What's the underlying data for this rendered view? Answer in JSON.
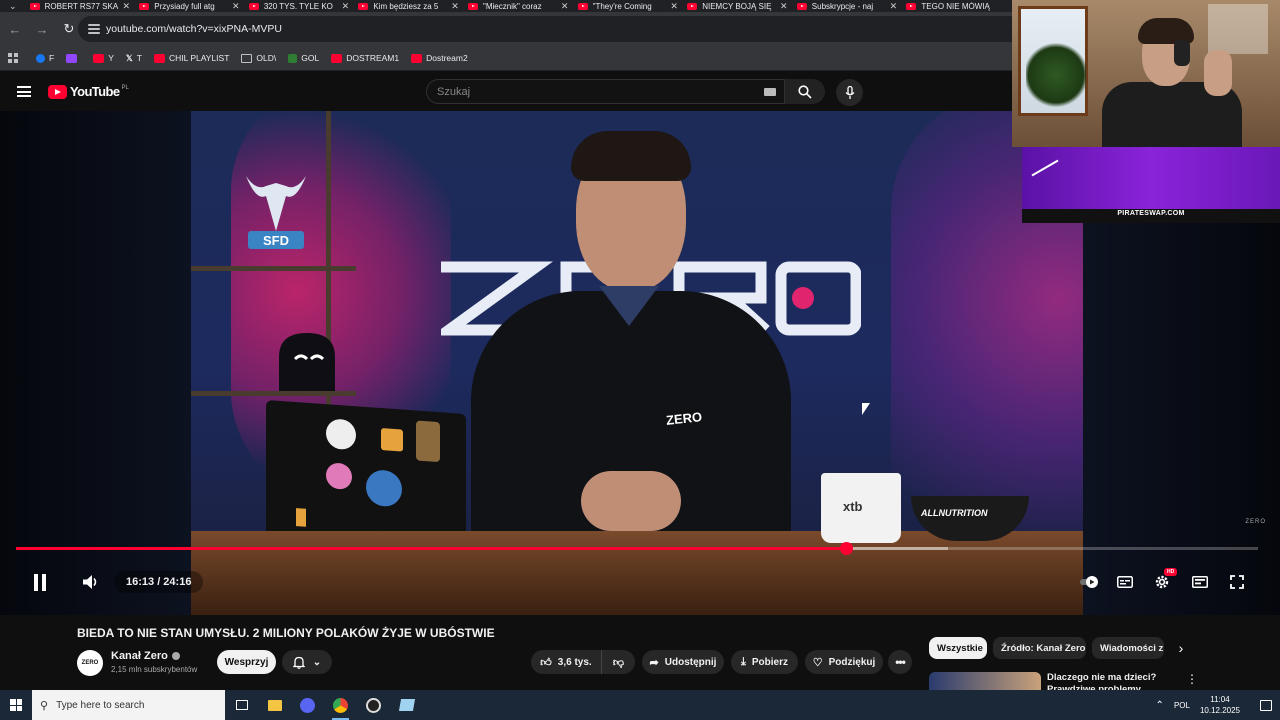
{
  "browser": {
    "tabs": [
      {
        "title": "ROBERT RS77 SKA"
      },
      {
        "title": "Przysiady full atg"
      },
      {
        "title": "320 TYS. TYLE KO"
      },
      {
        "title": "Kim będziesz za 5"
      },
      {
        "title": "\"Miecznik\" coraz"
      },
      {
        "title": "\"They're Coming"
      },
      {
        "title": "NIEMCY BOJĄ SIĘ"
      },
      {
        "title": "Subskrypcje - naj"
      },
      {
        "title": "TEGO NIE MÓWIĄ"
      }
    ],
    "url": "youtube.com/watch?v=xixPNA-MVPU",
    "bookmarks": [
      {
        "label": "F",
        "color": "#1877f2"
      },
      {
        "label": "",
        "color": "#9146ff"
      },
      {
        "label": "Y",
        "color": "#ff0033"
      },
      {
        "label": "T",
        "color": "#000000"
      },
      {
        "label": "CHIL PLAYLIST",
        "color": "#ff0033"
      },
      {
        "label": "OLD\\",
        "color": "folder"
      },
      {
        "label": "GOL",
        "color": "#2e7d32"
      },
      {
        "label": "DOSTREAM1",
        "color": "#ff0033"
      },
      {
        "label": "Dostream2",
        "color": "#ff0033"
      }
    ]
  },
  "youtube": {
    "logo_text": "YouTube",
    "country_code": "PL",
    "search_placeholder": "Szukaj"
  },
  "player": {
    "current_time": "16:13",
    "duration": "24:16",
    "time_display": "16:13 / 24:16",
    "progress": 0.668,
    "buffered": 0.75,
    "hd_badge": "HD",
    "watermark": "ZERO",
    "video_zero_logo": "ZERO",
    "mug_brand": "xtb",
    "bowl_brand": "ALLNUTRITION"
  },
  "video_info": {
    "title": "BIEDA TO NIE STAN UMYSŁU. 2 MILIONY POLAKÓW ŻYJE W UBÓSTWIE",
    "channel_name": "Kanał Zero",
    "channel_avatar_text": "ZERO",
    "subscribers": "2,15 mln subskrybentów",
    "support_button": "Wesprzyj",
    "likes": "3,6 tys.",
    "share": "Udostępnij",
    "download": "Pobierz",
    "thanks": "Podziękuj"
  },
  "sidebar": {
    "chips": [
      "Wszystkie",
      "Źródło: Kanał Zero",
      "Wiadomości z"
    ],
    "rec_title": "Dlaczego nie ma dzieci? Prawdziwe problemy młodych"
  },
  "stream_overlay": {
    "banner_text": "PIRATESWAP.COM"
  },
  "taskbar": {
    "search_placeholder": "Type here to search",
    "language": "POL",
    "time": "11:04",
    "date": "10.12.2025"
  },
  "colors": {
    "yt_red": "#ff0033",
    "bg": "#0f0f0f",
    "banner_purple": "#8a23d9"
  }
}
